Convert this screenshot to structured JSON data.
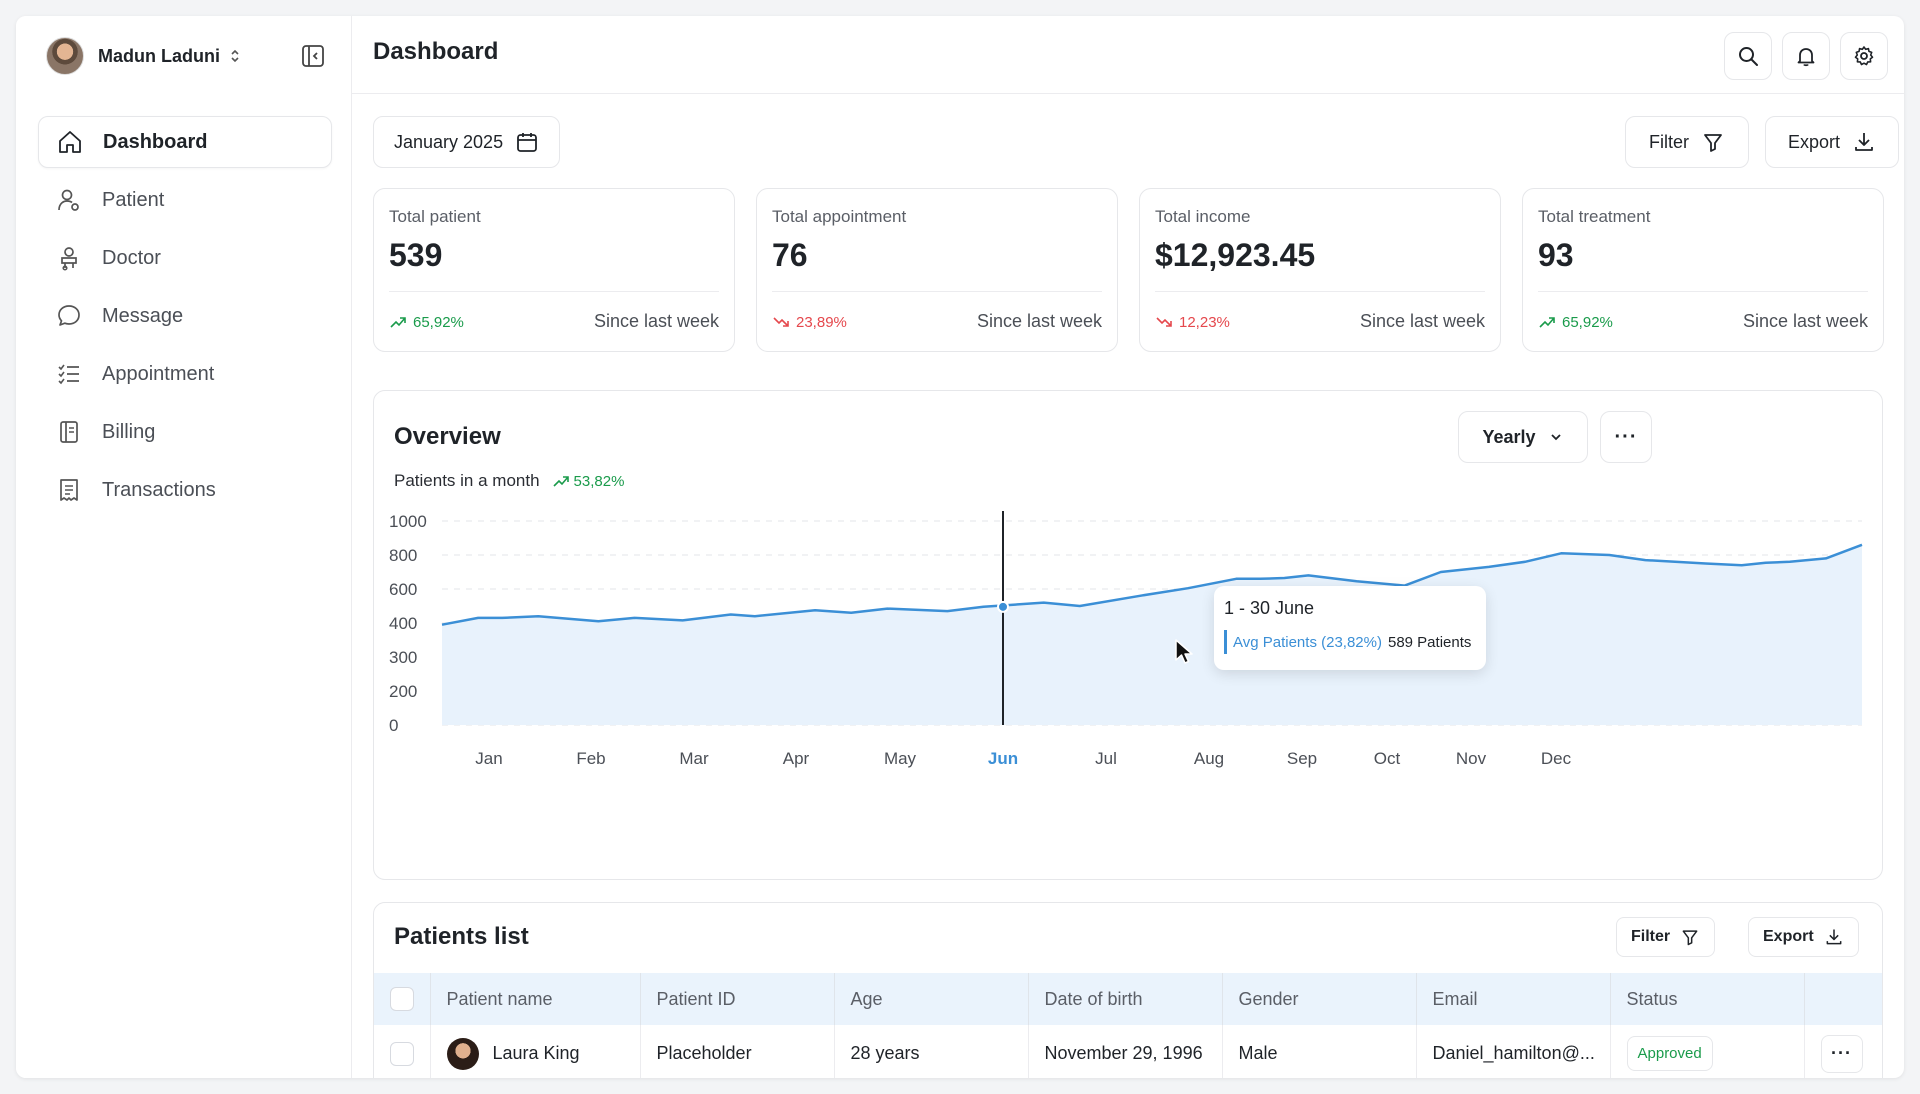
{
  "user": {
    "name": "Madun Laduni"
  },
  "sidebar": {
    "items": [
      {
        "label": "Dashboard",
        "icon": "home-icon"
      },
      {
        "label": "Patient",
        "icon": "user-icon"
      },
      {
        "label": "Doctor",
        "icon": "doctor-icon"
      },
      {
        "label": "Message",
        "icon": "message-icon"
      },
      {
        "label": "Appointment",
        "icon": "list-icon"
      },
      {
        "label": "Billing",
        "icon": "billing-icon"
      },
      {
        "label": "Transactions",
        "icon": "receipt-icon"
      }
    ]
  },
  "header": {
    "title": "Dashboard"
  },
  "toolbar": {
    "date": "January 2025",
    "filter": "Filter",
    "export": "Export"
  },
  "stats": [
    {
      "label": "Total patient",
      "value": "539",
      "delta": "65,92%",
      "trend": "up",
      "since": "Since last week"
    },
    {
      "label": "Total appointment",
      "value": "76",
      "delta": "23,89%",
      "trend": "down",
      "since": "Since last week"
    },
    {
      "label": "Total income",
      "value": "$12,923.45",
      "delta": "12,23%",
      "trend": "down",
      "since": "Since last week"
    },
    {
      "label": "Total treatment",
      "value": "93",
      "delta": "65,92%",
      "trend": "up",
      "since": "Since last week"
    }
  ],
  "overview": {
    "title": "Overview",
    "subtitle": "Patients in a month",
    "subtitle_delta": "53,82%",
    "period": "Yearly",
    "more": "···",
    "tooltip": {
      "title": "1 - 30 June",
      "series": "Avg Patients (23,82%)",
      "value": "589 Patients"
    }
  },
  "chart_data": {
    "type": "area",
    "y_ticks": [
      "1000",
      "800",
      "600",
      "400",
      "300",
      "200",
      "0"
    ],
    "categories": [
      "Jan",
      "Feb",
      "Mar",
      "Apr",
      "May",
      "Jun",
      "Jul",
      "Aug",
      "Sep",
      "Oct",
      "Nov",
      "Dec"
    ],
    "highlight": "Jun",
    "x": [
      0,
      0.3,
      0.5,
      0.8,
      1.3,
      1.6,
      2.0,
      2.4,
      2.6,
      3.1,
      3.4,
      3.7,
      4.2,
      4.5,
      5.0,
      5.3,
      5.8,
      6.2,
      6.6,
      6.8,
      7.0,
      7.2,
      7.6,
      8.0,
      8.3,
      8.7,
      9.0,
      9.3,
      9.7,
      10.0,
      10.5,
      10.8,
      11.0,
      11.2,
      11.5,
      11.8
    ],
    "values": [
      395,
      430,
      430,
      440,
      410,
      430,
      415,
      450,
      440,
      475,
      460,
      485,
      470,
      495,
      520,
      500,
      560,
      605,
      660,
      660,
      665,
      680,
      645,
      620,
      700,
      730,
      760,
      810,
      800,
      770,
      750,
      740,
      755,
      760,
      780,
      860
    ],
    "series": [
      {
        "name": "Avg Patients (23,82%)"
      }
    ],
    "color": "#3b8fd6",
    "fill": "#e8f2fc"
  },
  "patients": {
    "title": "Patients list",
    "filter": "Filter",
    "export": "Export",
    "columns": [
      "Patient name",
      "Patient ID",
      "Age",
      "Date of birth",
      "Gender",
      "Email",
      "Status"
    ],
    "rows": [
      {
        "name": "Laura King",
        "id": "Placeholder",
        "age": "28 years",
        "dob": "November 29, 1996",
        "gender": "Male",
        "email": "Daniel_hamilton@...",
        "status": "Approved"
      }
    ]
  },
  "colors": {
    "accent": "#3b8fd6",
    "up": "#1a9b4b",
    "down": "#e5484d",
    "header_bg": "#eaf3fc"
  }
}
